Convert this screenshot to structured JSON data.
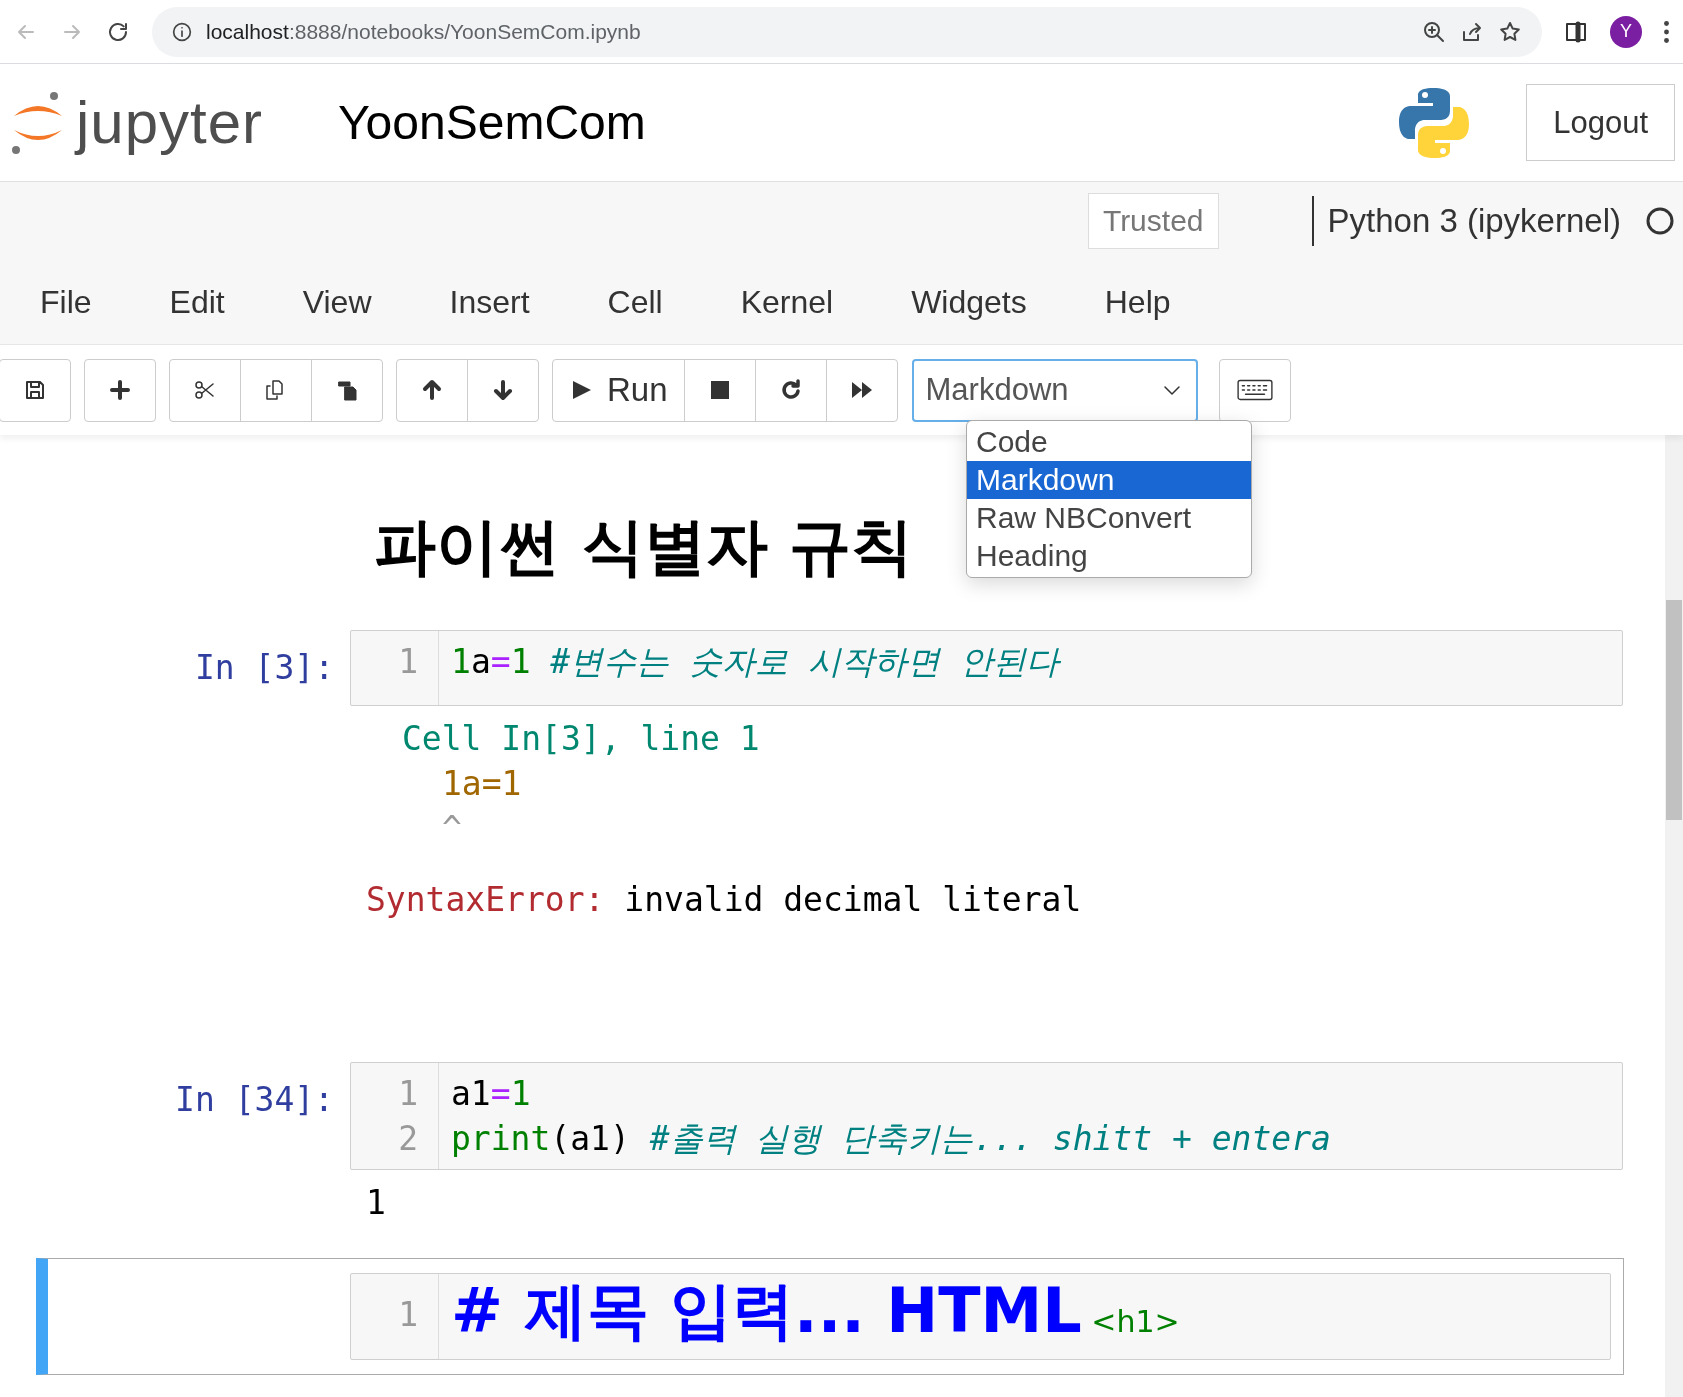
{
  "browser": {
    "url_host": "localhost",
    "url_rest": ":8888/notebooks/YoonSemCom.ipynb",
    "avatar": "Y"
  },
  "header": {
    "logo_text": "jupyter",
    "notebook_name": "YoonSemCom",
    "logout": "Logout"
  },
  "status": {
    "trusted": "Trusted",
    "kernel": "Python 3 (ipykernel)"
  },
  "menu": [
    "File",
    "Edit",
    "View",
    "Insert",
    "Cell",
    "Kernel",
    "Widgets",
    "Help"
  ],
  "toolbar": {
    "run": "Run",
    "cell_type": "Markdown",
    "dropdown": [
      {
        "label": "Code",
        "selected": false
      },
      {
        "label": "Markdown",
        "selected": true
      },
      {
        "label": "Raw NBConvert",
        "selected": false
      },
      {
        "label": "Heading",
        "selected": false
      }
    ]
  },
  "cells": [
    {
      "kind": "heading",
      "text": "파이썬 식별자 규칙",
      "selected": false
    },
    {
      "kind": "code",
      "prompt": "In [3]:",
      "selected": false,
      "lines": [
        {
          "number": "1",
          "tokens": [
            {
              "text": "1",
              "kind": "number"
            },
            {
              "text": "a",
              "kind": "name"
            },
            {
              "text": "=",
              "kind": "operator"
            },
            {
              "text": "1",
              "kind": "number"
            },
            {
              "text": " #변수는 숫자로 시작하면 안된다",
              "kind": "comment"
            }
          ]
        }
      ],
      "output": {
        "kind": "error",
        "lines": [
          {
            "text": "Cell In[3], line 1",
            "kind": "location"
          },
          {
            "text": "1a=1",
            "kind": "source"
          },
          {
            "text": "^",
            "kind": "caret"
          }
        ],
        "error_name": "SyntaxError:",
        "error_message": " invalid decimal literal"
      }
    },
    {
      "kind": "code",
      "prompt": "In [34]:",
      "selected": false,
      "lines": [
        {
          "number": "1",
          "tokens": [
            {
              "text": "a1",
              "kind": "name"
            },
            {
              "text": "=",
              "kind": "operator"
            },
            {
              "text": "1",
              "kind": "number"
            }
          ]
        },
        {
          "number": "2",
          "tokens": [
            {
              "text": "print",
              "kind": "builtin"
            },
            {
              "text": "(a1)",
              "kind": "name"
            },
            {
              "text": " #출력 실행 단축키는... shitt + entera",
              "kind": "comment"
            }
          ]
        }
      ],
      "output": {
        "kind": "stream",
        "text": "1"
      }
    },
    {
      "kind": "markdown",
      "selected": true,
      "lines": [
        {
          "number": "1",
          "tokens": [
            {
              "text": "# 제목 입력... HTML",
              "kind": "header"
            },
            {
              "text": " <h1>",
              "kind": "tag"
            }
          ]
        }
      ]
    }
  ]
}
